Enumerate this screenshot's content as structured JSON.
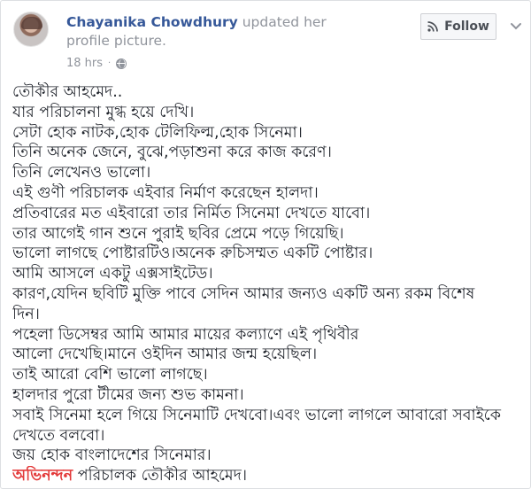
{
  "post": {
    "author": "Chayanika Chowdhury",
    "action": " updated her profile picture.",
    "time": "18 hrs",
    "separator": "·",
    "privacy_icon": "globe-icon",
    "follow_label": "Follow",
    "follow_icon": "rss-icon",
    "menu_icon": "chevron-down-icon",
    "lines": [
      "তৌকীর আহমেদ..",
      "যার পরিচালনা মুগ্ধ হয়ে দেখি।",
      "সেটা হোক নাটক,হোক টেলিফিল্ম,হোক সিনেমা।",
      "তিনি অনেক জেনে, বুঝে,পড়াশুনা করে কাজ করেণ।",
      "তিনি লেখেনও ভালো।",
      "এই গুণী পরিচালক এইবার নির্মাণ করেছেন হালদা।",
      "প্রতিবারের মত এইবারো তার নির্মিত সিনেমা দেখতে যাবো।",
      "তার আগেই গান শুনে পুরাই ছবির প্রেমে পড়ে গিয়েছি।",
      "ভালো লাগছে পোষ্টারটিও।অনেক রুচিসম্মত একটি পোষ্টার।",
      "আমি আসলে একটু এক্সসাইটেড।",
      "কারণ,যেদিন ছবিটি মুক্তি পাবে সেদিন আমার জন্যও একটি অন্য রকম বিশেষ",
      "দিন।",
      "পহেলা ডিসেম্বর আমি আমার মায়ের কল্যাণে এই পৃথিবীর",
      "আলো দেখেছি।মানে ওইদিন আমার জন্ম হয়েছিল।",
      "তাই আরো বেশি ভালো লাগছে।",
      "হালদার পুরো টীমের জন্য শুভ কামনা।",
      "সবাই সিনেমা হলে গিয়ে সিনেমাটি দেখবো।এবং ভালো লাগলে আবারো সবাইকে",
      "দেখতে বলবো।",
      "জয় হোক বাংলাদেশের সিনেমার।"
    ],
    "last_line_highlight": "অভিনন্দন",
    "last_line_rest": " পরিচালক তৌকীর আহমেদ।",
    "colors": {
      "link": "#365899",
      "meta": "#90949c",
      "highlight": "#e33a3a"
    }
  }
}
